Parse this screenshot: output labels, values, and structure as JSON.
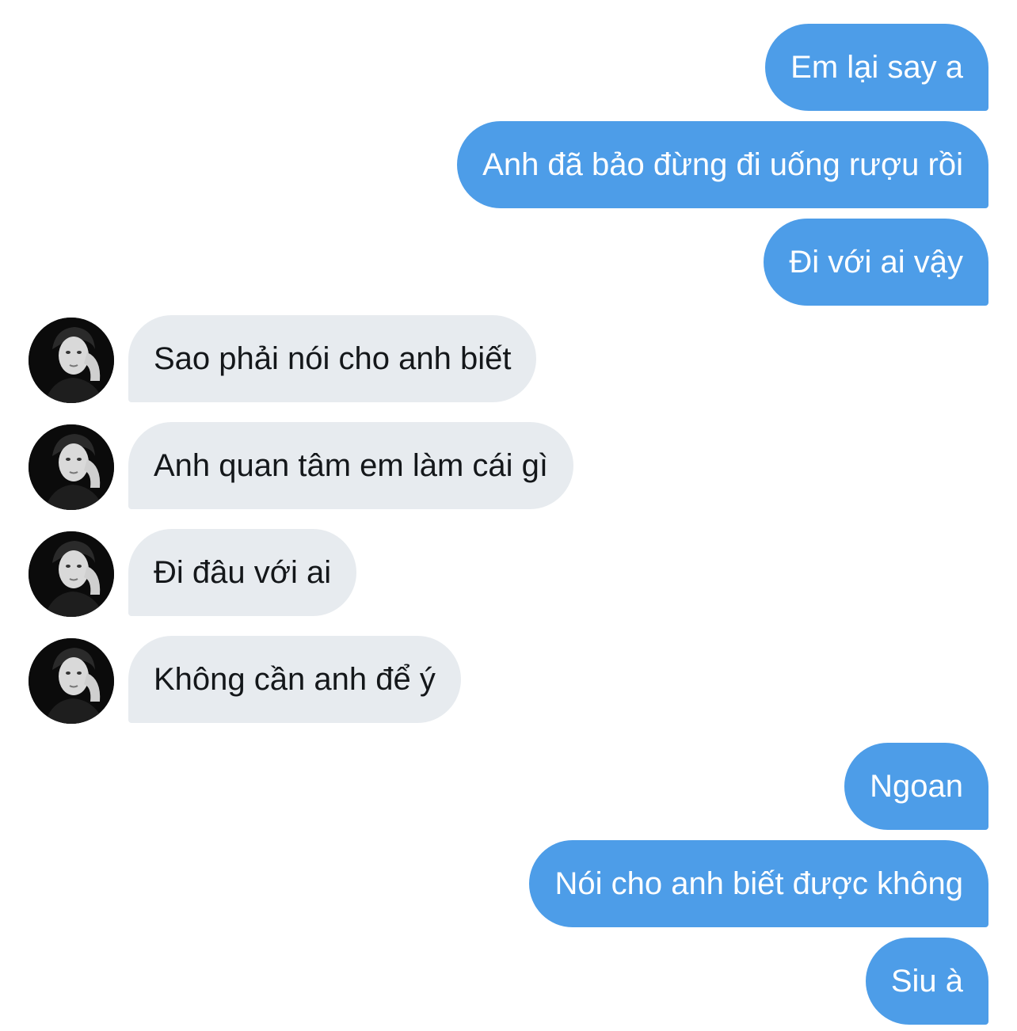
{
  "conversation": {
    "colors": {
      "sent_bubble": "#4d9de8",
      "sent_text": "#ffffff",
      "received_bubble": "#e7ebef",
      "received_text": "#14171a"
    },
    "messages": [
      {
        "sender": "me",
        "text": "Em lại say a"
      },
      {
        "sender": "me",
        "text": "Anh đã bảo đừng đi uống rượu rồi"
      },
      {
        "sender": "me",
        "text": "Đi với ai vậy"
      },
      {
        "sender": "them",
        "text": "Sao phải nói cho anh biết",
        "avatar_icon": "avatar-photo-icon"
      },
      {
        "sender": "them",
        "text": "Anh quan tâm em làm cái gì",
        "avatar_icon": "avatar-photo-icon"
      },
      {
        "sender": "them",
        "text": "Đi đâu với ai",
        "avatar_icon": "avatar-photo-icon"
      },
      {
        "sender": "them",
        "text": "Không cần anh để ý",
        "avatar_icon": "avatar-photo-icon"
      },
      {
        "sender": "me",
        "text": "Ngoan"
      },
      {
        "sender": "me",
        "text": "Nói cho anh biết được không"
      },
      {
        "sender": "me",
        "text": "Siu à"
      }
    ]
  }
}
